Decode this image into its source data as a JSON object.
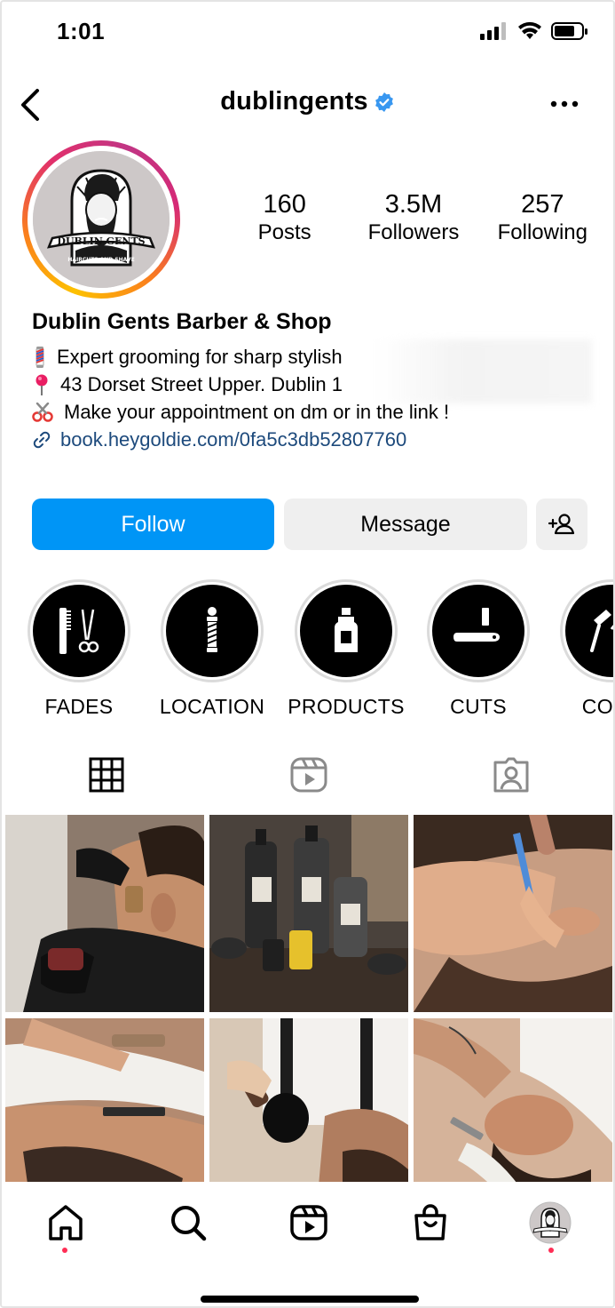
{
  "status_bar": {
    "time": "1:01"
  },
  "header": {
    "username": "dublingents",
    "verified": true
  },
  "profile": {
    "logo_text": "DUBLIN GENTS",
    "logo_subtext": "HAIRCUTS AND SHAVE",
    "stats": [
      {
        "value": "160",
        "label": "Posts"
      },
      {
        "value": "3.5M",
        "label": "Followers"
      },
      {
        "value": "257",
        "label": "Following"
      }
    ],
    "display_name": "Dublin Gents Barber & Shop",
    "bio": [
      {
        "icon": "barber-pole-emoji",
        "text": "Expert grooming for sharp stylish"
      },
      {
        "icon": "pushpin-emoji",
        "text": "43 Dorset Street Upper. Dublin 1"
      },
      {
        "icon": "scissors-emoji",
        "text": "Make your appointment on dm or in the link !"
      }
    ],
    "link": "book.heygoldie.com/0fa5c3db52807760"
  },
  "actions": {
    "follow": "Follow",
    "message": "Message"
  },
  "highlights": [
    {
      "label": "FADES",
      "icon": "comb-scissors-icon"
    },
    {
      "label": "LOCATION",
      "icon": "barber-pole-icon"
    },
    {
      "label": "PRODUCTS",
      "icon": "product-bottle-icon"
    },
    {
      "label": "CUTS",
      "icon": "razor-icon"
    },
    {
      "label": "COLO",
      "icon": "dye-brush-icon"
    }
  ],
  "colors": {
    "follow_blue": "#0095f6",
    "link_blue": "#1d4a7c",
    "notification_dot": "#ff2d55"
  },
  "bottom_nav": [
    "home-icon",
    "search-icon",
    "reels-icon",
    "shop-icon",
    "profile-avatar"
  ]
}
